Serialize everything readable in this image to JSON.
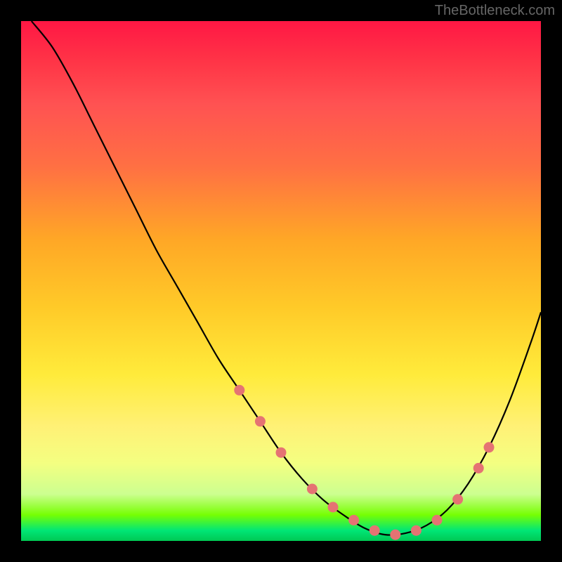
{
  "watermark": "TheBottleneck.com",
  "chart_data": {
    "type": "line",
    "title": "",
    "xlabel": "",
    "ylabel": "",
    "xlim": [
      0,
      100
    ],
    "ylim": [
      0,
      100
    ],
    "background": "traffic-light-gradient",
    "curve": {
      "name": "bottleneck-curve",
      "x": [
        2,
        6,
        10,
        14,
        18,
        22,
        26,
        30,
        34,
        38,
        42,
        46,
        50,
        54,
        58,
        62,
        66,
        70,
        74,
        78,
        82,
        86,
        90,
        94,
        98,
        100
      ],
      "y": [
        100,
        95,
        88,
        80,
        72,
        64,
        56,
        49,
        42,
        35,
        29,
        23,
        17,
        12,
        8,
        5,
        2.5,
        1.2,
        1.5,
        3,
        6,
        11,
        18,
        27,
        38,
        44
      ]
    },
    "markers": {
      "name": "highlight-points",
      "color": "#e57373",
      "x": [
        42,
        46,
        50,
        56,
        60,
        64,
        68,
        72,
        76,
        80,
        84,
        88,
        90
      ],
      "y": [
        29,
        23,
        17,
        10,
        6.5,
        4,
        2,
        1.2,
        2,
        4,
        8,
        14,
        18
      ]
    }
  }
}
